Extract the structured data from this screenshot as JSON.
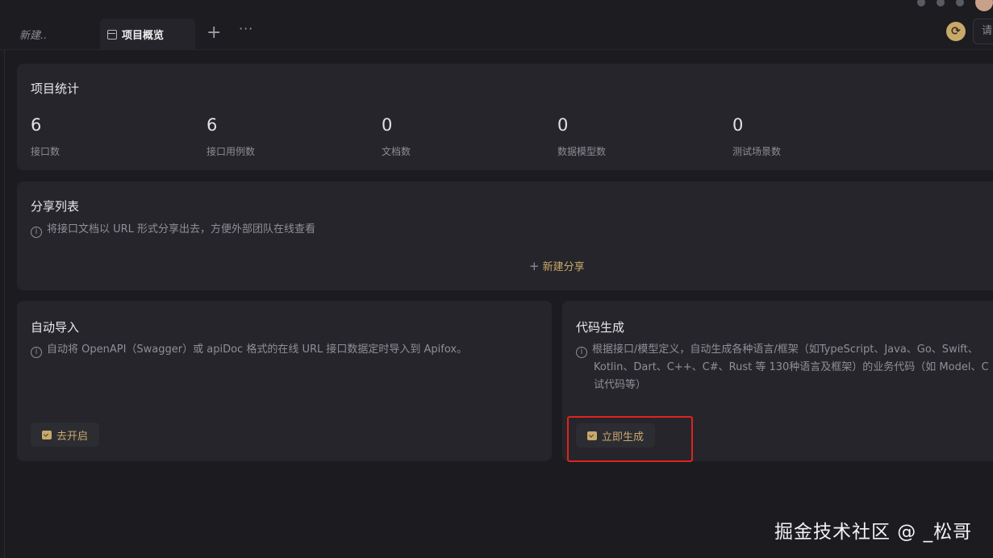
{
  "tabs": {
    "new_tab_label": "新建..",
    "active_tab_label": "项目概览",
    "add_tab": "+",
    "more": "···"
  },
  "search": {
    "placeholder": "请"
  },
  "stats": {
    "title": "项目统计",
    "items": [
      {
        "value": "6",
        "label": "接口数"
      },
      {
        "value": "6",
        "label": "接口用例数"
      },
      {
        "value": "0",
        "label": "文档数"
      },
      {
        "value": "0",
        "label": "数据模型数"
      },
      {
        "value": "0",
        "label": "测试场景数"
      }
    ]
  },
  "share": {
    "title": "分享列表",
    "info": "将接口文档以 URL 形式分享出去，方便外部团队在线查看",
    "new_share_label": "新建分享"
  },
  "auto_import": {
    "title": "自动导入",
    "info": "自动将 OpenAPI（Swagger）或 apiDoc 格式的在线 URL 接口数据定时导入到 Apifox。",
    "button_label": "去开启"
  },
  "codegen": {
    "title": "代码生成",
    "info_lines": [
      "根据接口/模型定义，自动生成各种语言/框架（如TypeScript、Java、Go、Swift、",
      "Kotlin、Dart、C++、C#、Rust 等 130种语言及框架）的业务代码（如 Model、C",
      "试代码等）"
    ],
    "button_label": "立即生成"
  },
  "watermark": "掘金技术社区 @ _松哥",
  "colors": {
    "accent": "#c9a96a",
    "highlight": "#e0231d",
    "background": "#1b1b20",
    "card": "#25252b"
  }
}
